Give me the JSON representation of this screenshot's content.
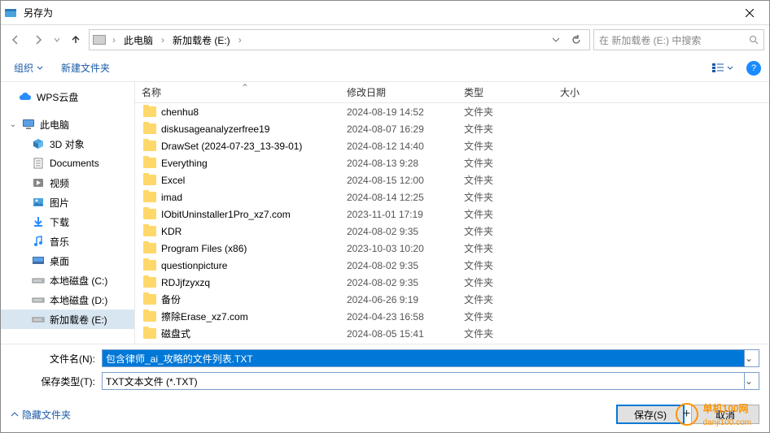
{
  "titlebar": {
    "title": "另存为"
  },
  "navbar": {
    "breadcrumbs": [
      "此电脑",
      "新加载卷 (E:)"
    ],
    "search_placeholder": "在 新加载卷 (E:) 中搜索"
  },
  "toolbar": {
    "organize": "组织",
    "new_folder": "新建文件夹"
  },
  "sidebar": {
    "wps": "WPS云盘",
    "this_pc": "此电脑",
    "items": [
      {
        "label": "3D 对象"
      },
      {
        "label": "Documents"
      },
      {
        "label": "视频"
      },
      {
        "label": "图片"
      },
      {
        "label": "下载"
      },
      {
        "label": "音乐"
      },
      {
        "label": "桌面"
      },
      {
        "label": "本地磁盘 (C:)"
      },
      {
        "label": "本地磁盘 (D:)"
      },
      {
        "label": "新加载卷 (E:)"
      }
    ]
  },
  "columns": {
    "name": "名称",
    "date": "修改日期",
    "type": "类型",
    "size": "大小"
  },
  "files": [
    {
      "name": "chenhu8",
      "date": "2024-08-19 14:52",
      "type": "文件夹"
    },
    {
      "name": "diskusageanalyzerfree19",
      "date": "2024-08-07 16:29",
      "type": "文件夹"
    },
    {
      "name": "DrawSet (2024-07-23_13-39-01)",
      "date": "2024-08-12 14:40",
      "type": "文件夹"
    },
    {
      "name": "Everything",
      "date": "2024-08-13 9:28",
      "type": "文件夹"
    },
    {
      "name": "Excel",
      "date": "2024-08-15 12:00",
      "type": "文件夹"
    },
    {
      "name": "imad",
      "date": "2024-08-14 12:25",
      "type": "文件夹"
    },
    {
      "name": "IObitUninstaller1Pro_xz7.com",
      "date": "2023-11-01 17:19",
      "type": "文件夹"
    },
    {
      "name": "KDR",
      "date": "2024-08-02 9:35",
      "type": "文件夹"
    },
    {
      "name": "Program Files (x86)",
      "date": "2023-10-03 10:20",
      "type": "文件夹"
    },
    {
      "name": "questionpicture",
      "date": "2024-08-02 9:35",
      "type": "文件夹"
    },
    {
      "name": "RDJjfzyxzq",
      "date": "2024-08-02 9:35",
      "type": "文件夹"
    },
    {
      "name": "备份",
      "date": "2024-06-26 9:19",
      "type": "文件夹"
    },
    {
      "name": "擦除Erase_xz7.com",
      "date": "2024-04-23 16:58",
      "type": "文件夹"
    },
    {
      "name": "磁盘式",
      "date": "2024-08-05 15:41",
      "type": "文件夹"
    }
  ],
  "form": {
    "filename_label": "文件名(N):",
    "filename_value": "包含律师_ai_攻略的文件列表.TXT",
    "filetype_label": "保存类型(T):",
    "filetype_value": "TXT文本文件 (*.TXT)"
  },
  "actions": {
    "hide_folders": "隐藏文件夹",
    "save": "保存(S)",
    "cancel": "取消"
  },
  "watermark": {
    "text_cn": "单机100网",
    "text_en": "danji100.com"
  }
}
